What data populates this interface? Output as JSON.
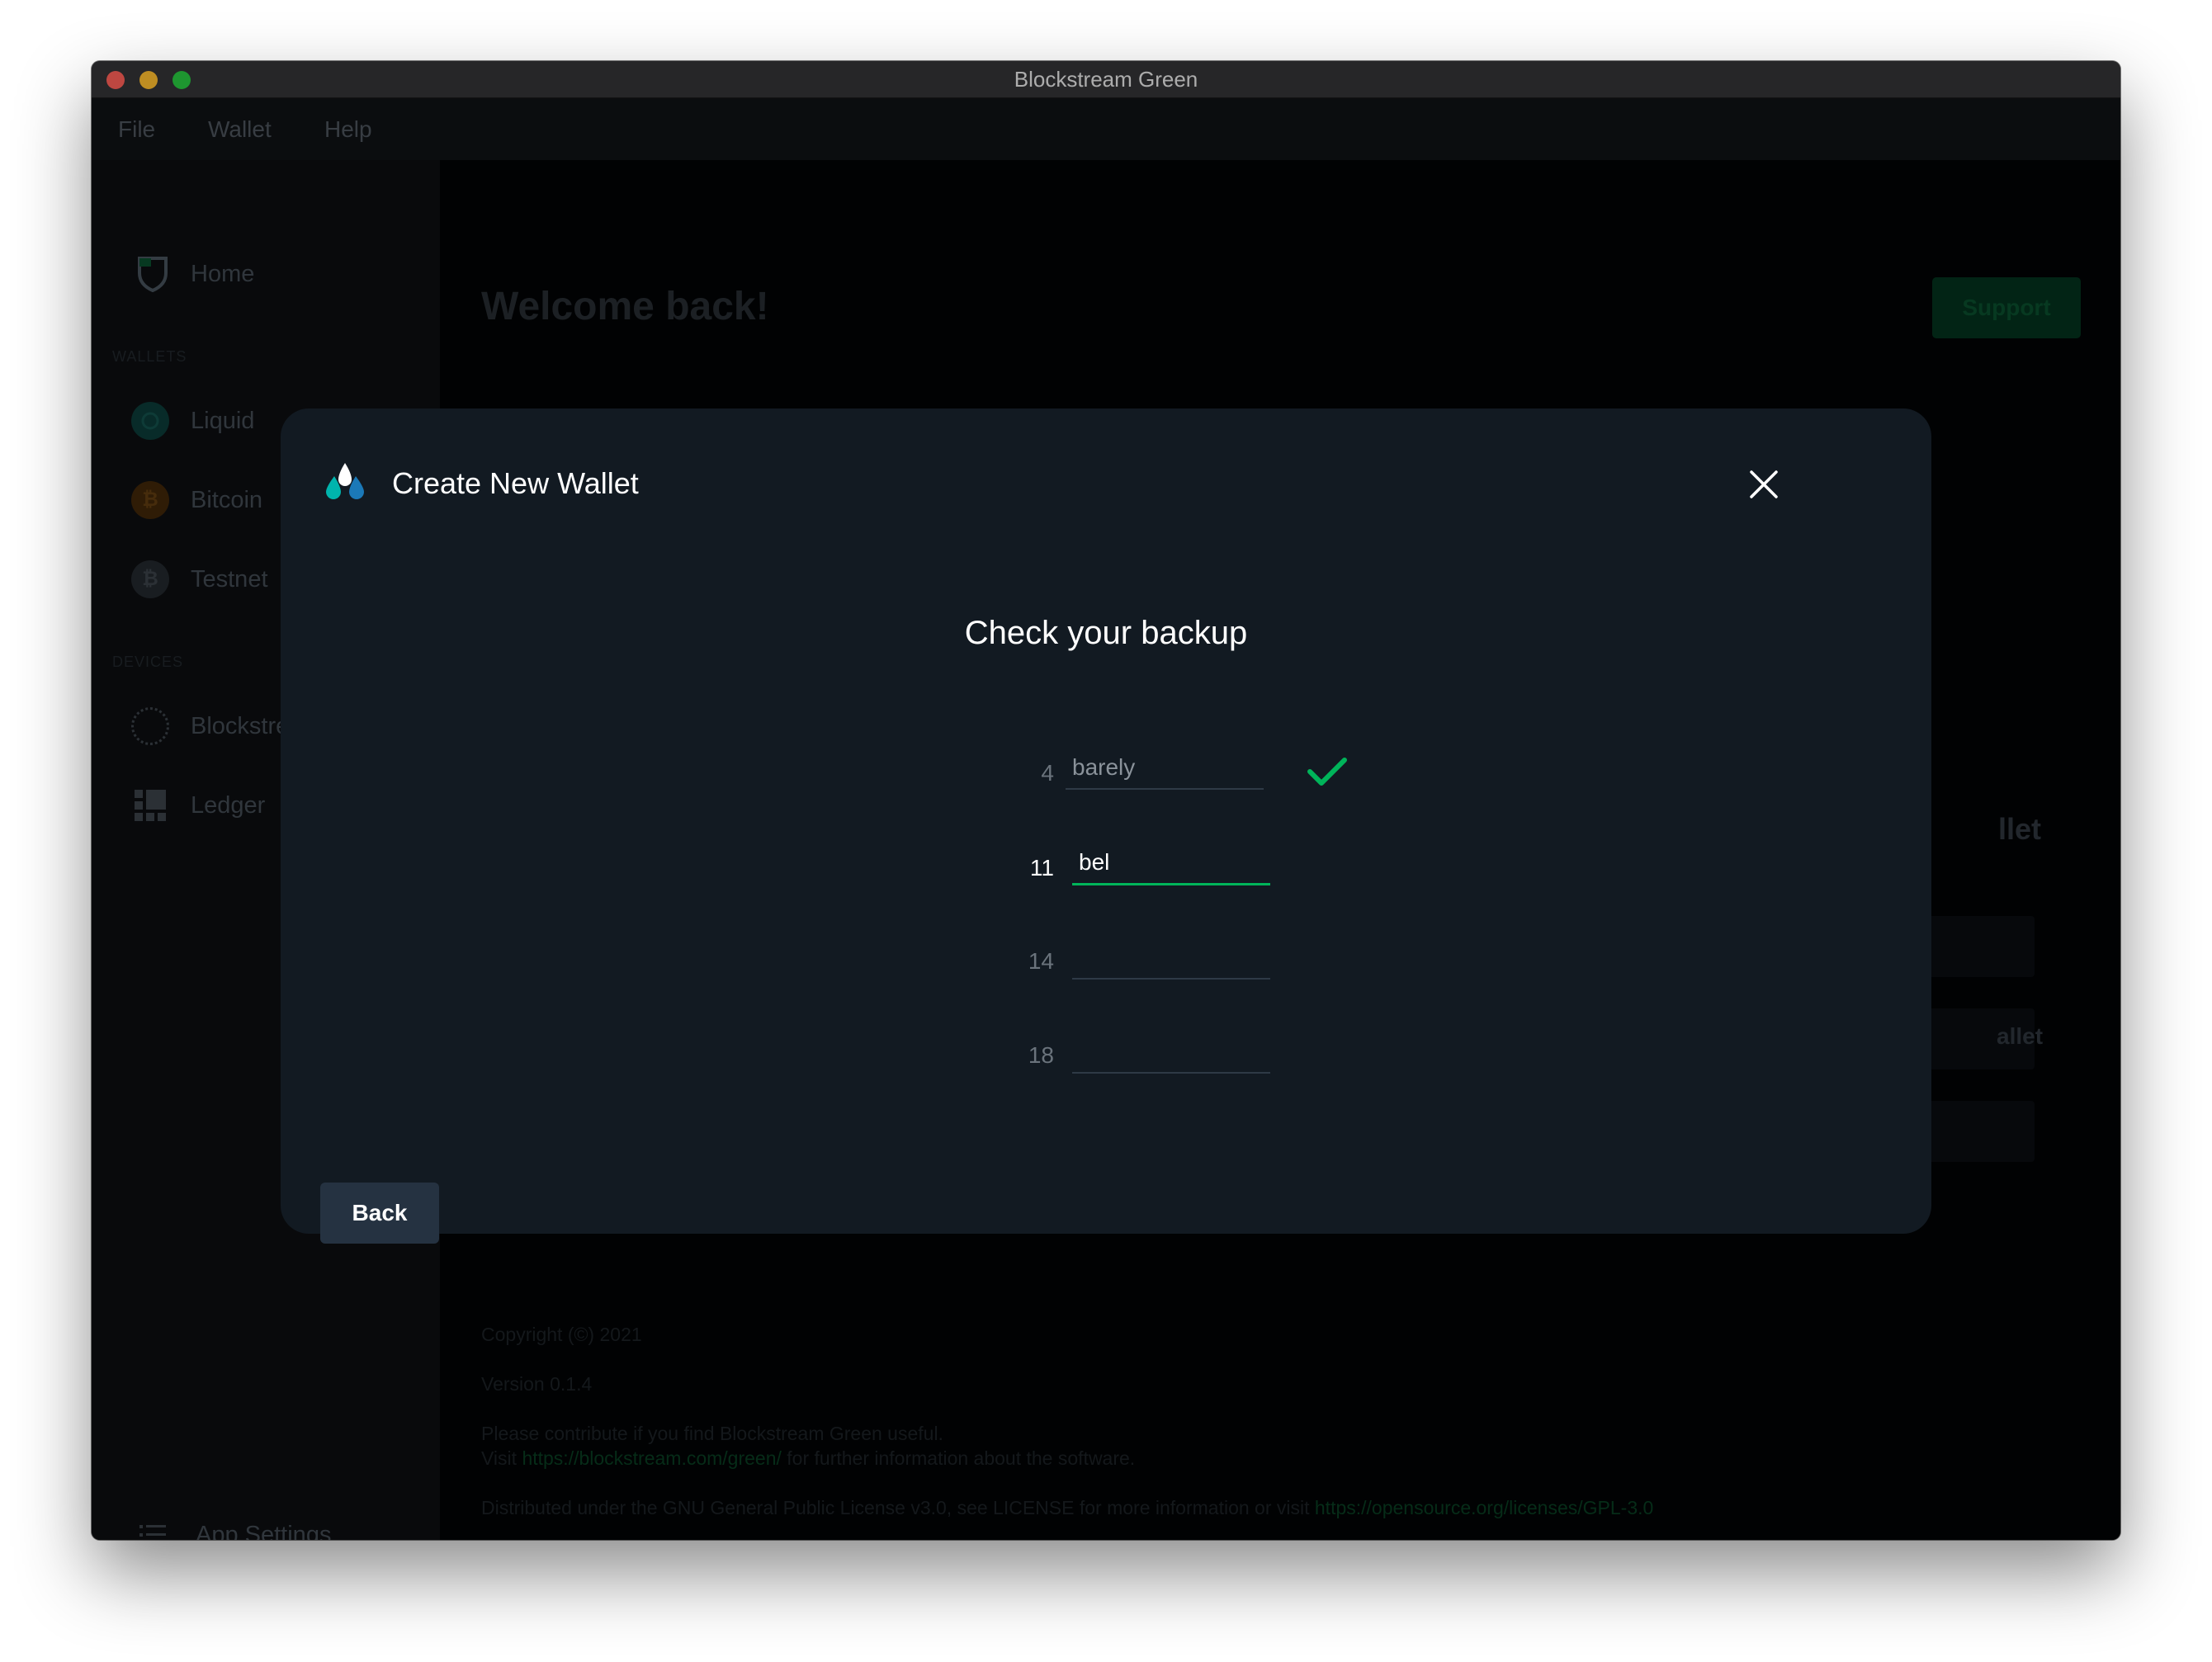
{
  "window": {
    "title": "Blockstream Green"
  },
  "menubar": {
    "items": [
      "File",
      "Wallet",
      "Help"
    ]
  },
  "sidebar": {
    "home_label": "Home",
    "wallets_section": "WALLETS",
    "wallets": [
      {
        "label": "Liquid",
        "icon": "liquid-icon"
      },
      {
        "label": "Bitcoin",
        "icon": "bitcoin-icon"
      },
      {
        "label": "Testnet",
        "icon": "testnet-icon"
      }
    ],
    "devices_section": "DEVICES",
    "devices": [
      {
        "label": "Blockstre",
        "icon": "jade-device-icon"
      },
      {
        "label": "Ledger",
        "icon": "ledger-icon"
      }
    ],
    "settings_label": "App Settings"
  },
  "main": {
    "welcome": "Welcome back!",
    "support_label": "Support",
    "bg_fragment_1": "llet",
    "bg_fragment_2": "allet",
    "footer": {
      "copyright": "Copyright (©) 2021",
      "version": "Version 0.1.4",
      "contribute": "Please contribute if you find Blockstream Green useful.",
      "visit_prefix": "Visit ",
      "visit_link": "https://blockstream.com/green/",
      "visit_suffix": " for further information about the software.",
      "license_prefix": "Distributed under the GNU General Public License v3.0, see LICENSE for more information or visit ",
      "license_link": "https://opensource.org/licenses/GPL-3.0"
    }
  },
  "dialog": {
    "title": "Create New Wallet",
    "heading": "Check your backup",
    "words": [
      {
        "number": "4",
        "value": "barely",
        "state": "verified"
      },
      {
        "number": "11",
        "value": "bel",
        "state": "active"
      },
      {
        "number": "14",
        "value": "",
        "state": "pending"
      },
      {
        "number": "18",
        "value": "",
        "state": "pending"
      }
    ],
    "back_label": "Back"
  },
  "colors": {
    "accent_green": "#00b45a",
    "dialog_bg": "#121a22",
    "button_bg": "#253241"
  }
}
